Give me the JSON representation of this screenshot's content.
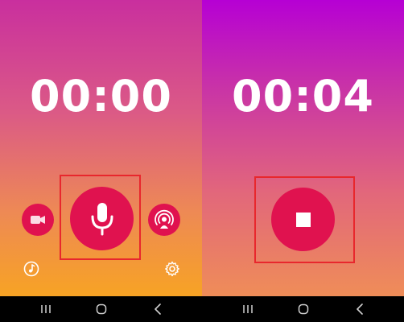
{
  "left_screen": {
    "timer": "00:00",
    "record_button": {
      "icon": "microphone-icon"
    },
    "video_button": {
      "icon": "video-camera-icon"
    },
    "podcast_button": {
      "icon": "podcast-icon"
    },
    "music_button": {
      "icon": "music-note-icon"
    },
    "settings_button": {
      "icon": "gear-icon"
    }
  },
  "right_screen": {
    "timer": "00:04",
    "stop_button": {
      "icon": "stop-icon"
    }
  },
  "nav_bar": {
    "items": [
      "recent-apps-icon",
      "home-icon",
      "back-icon"
    ]
  },
  "colors": {
    "accent": "#e0124f",
    "highlight_box": "#e8272d",
    "left_gradient_top": "#c92f9e",
    "left_gradient_bottom": "#f7a324",
    "right_gradient_top": "#b600d4",
    "right_gradient_bottom": "#ef8d58"
  }
}
